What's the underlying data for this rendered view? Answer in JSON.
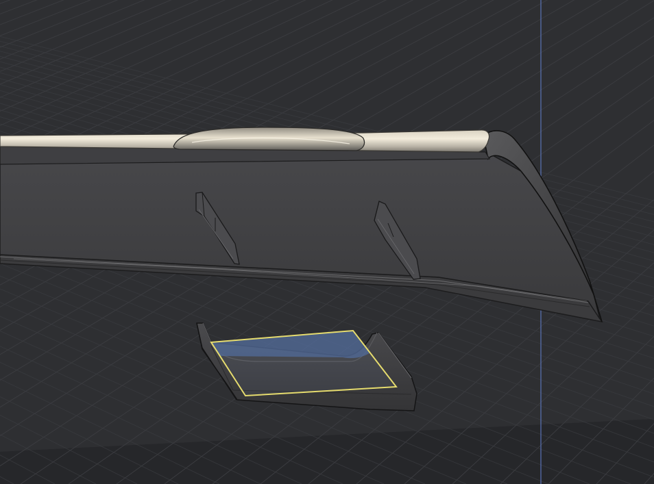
{
  "viewport": {
    "view": "3d-perspective",
    "grid_visible": true,
    "colors": {
      "background": "#26272a",
      "grid_floor": "#2f3033",
      "grid_line": "#3b3c40",
      "axis_line": "#5a73b8",
      "panel_dark": "#3d3d3f",
      "panel_mid": "#4a4a4c",
      "chrome_highlight": "#f2ead8",
      "selection_outline": "#e6dc6e",
      "selection_fill": "#4f6a9a"
    }
  },
  "objects": [
    {
      "name": "main-body-panel",
      "selected": false
    },
    {
      "name": "chrome-trim-strip",
      "selected": false
    },
    {
      "name": "rib-left",
      "selected": false
    },
    {
      "name": "rib-right",
      "selected": false
    },
    {
      "name": "lower-scoop-part",
      "selected": true
    },
    {
      "name": "selected-face",
      "selected": true
    }
  ]
}
